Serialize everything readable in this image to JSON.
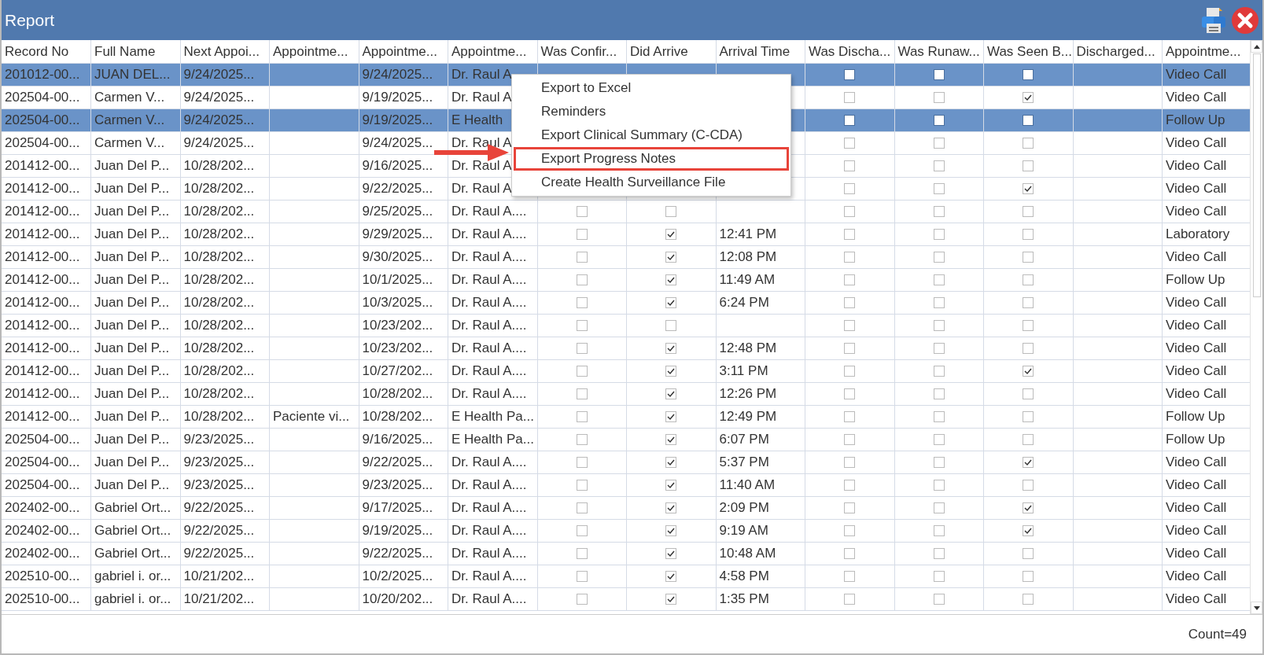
{
  "window": {
    "title": "Report"
  },
  "columns": [
    {
      "label": "Record No",
      "kind": "text"
    },
    {
      "label": "Full Name",
      "kind": "text"
    },
    {
      "label": "Next Appoi...",
      "kind": "text"
    },
    {
      "label": "Appointme...",
      "kind": "text"
    },
    {
      "label": "Appointme...",
      "kind": "text"
    },
    {
      "label": "Appointme...",
      "kind": "text"
    },
    {
      "label": "Was Confir...",
      "kind": "check"
    },
    {
      "label": "Did Arrive",
      "kind": "check"
    },
    {
      "label": "Arrival Time",
      "kind": "text"
    },
    {
      "label": "Was Discha...",
      "kind": "check"
    },
    {
      "label": "Was Runaw...",
      "kind": "check"
    },
    {
      "label": "Was Seen B...",
      "kind": "check"
    },
    {
      "label": "Discharged...",
      "kind": "text"
    },
    {
      "label": "Appointme...",
      "kind": "text"
    }
  ],
  "rows": [
    {
      "selected": true,
      "cells": [
        "201012-00...",
        "JUAN DEL...",
        "9/24/2025...",
        null,
        "9/24/2025...",
        "Dr. Raul A",
        null,
        null,
        null,
        {
          "checked": false
        },
        {
          "checked": false
        },
        {
          "checked": false
        },
        null,
        "Video Call"
      ]
    },
    {
      "selected": false,
      "cells": [
        "202504-00...",
        "Carmen V...",
        "9/24/2025...",
        null,
        "9/19/2025...",
        "Dr. Raul A",
        null,
        null,
        null,
        {
          "checked": false
        },
        {
          "checked": false
        },
        {
          "checked": true
        },
        null,
        "Video Call"
      ]
    },
    {
      "selected": true,
      "cells": [
        "202504-00...",
        "Carmen V...",
        "9/24/2025...",
        null,
        "9/19/2025...",
        "E Health",
        null,
        null,
        null,
        {
          "checked": false
        },
        {
          "checked": false
        },
        {
          "checked": false
        },
        null,
        "Follow Up"
      ]
    },
    {
      "selected": false,
      "cells": [
        "202504-00...",
        "Carmen V...",
        "9/24/2025...",
        null,
        "9/24/2025...",
        "Dr. Raul A",
        null,
        null,
        null,
        {
          "checked": false
        },
        {
          "checked": false
        },
        {
          "checked": false
        },
        null,
        "Video Call"
      ]
    },
    {
      "selected": false,
      "cells": [
        "201412-00...",
        "Juan Del P...",
        "10/28/202...",
        null,
        "9/16/2025...",
        "Dr. Raul A",
        null,
        null,
        null,
        {
          "checked": false
        },
        {
          "checked": false
        },
        {
          "checked": false
        },
        null,
        "Video Call"
      ]
    },
    {
      "selected": false,
      "cells": [
        "201412-00...",
        "Juan Del P...",
        "10/28/202...",
        null,
        "9/22/2025...",
        "Dr. Raul A",
        null,
        null,
        null,
        {
          "checked": false
        },
        {
          "checked": false
        },
        {
          "checked": true
        },
        null,
        "Video Call"
      ]
    },
    {
      "selected": false,
      "cells": [
        "201412-00...",
        "Juan Del P...",
        "10/28/202...",
        null,
        "9/25/2025...",
        "Dr. Raul A....",
        {
          "checked": false
        },
        {
          "checked": false
        },
        null,
        {
          "checked": false
        },
        {
          "checked": false
        },
        {
          "checked": false
        },
        null,
        "Video Call"
      ]
    },
    {
      "selected": false,
      "cells": [
        "201412-00...",
        "Juan Del P...",
        "10/28/202...",
        null,
        "9/29/2025...",
        "Dr. Raul A....",
        {
          "checked": false
        },
        {
          "checked": true
        },
        "12:41 PM",
        {
          "checked": false
        },
        {
          "checked": false
        },
        {
          "checked": false
        },
        null,
        "Laboratory"
      ]
    },
    {
      "selected": false,
      "cells": [
        "201412-00...",
        "Juan Del P...",
        "10/28/202...",
        null,
        "9/30/2025...",
        "Dr. Raul A....",
        {
          "checked": false
        },
        {
          "checked": true
        },
        "12:08 PM",
        {
          "checked": false
        },
        {
          "checked": false
        },
        {
          "checked": false
        },
        null,
        "Video Call"
      ]
    },
    {
      "selected": false,
      "cells": [
        "201412-00...",
        "Juan Del P...",
        "10/28/202...",
        null,
        "10/1/2025...",
        "Dr. Raul A....",
        {
          "checked": false
        },
        {
          "checked": true
        },
        "11:49 AM",
        {
          "checked": false
        },
        {
          "checked": false
        },
        {
          "checked": false
        },
        null,
        "Follow Up"
      ]
    },
    {
      "selected": false,
      "cells": [
        "201412-00...",
        "Juan Del P...",
        "10/28/202...",
        null,
        "10/3/2025...",
        "Dr. Raul A....",
        {
          "checked": false
        },
        {
          "checked": true
        },
        "6:24 PM",
        {
          "checked": false
        },
        {
          "checked": false
        },
        {
          "checked": false
        },
        null,
        "Video Call"
      ]
    },
    {
      "selected": false,
      "cells": [
        "201412-00...",
        "Juan Del P...",
        "10/28/202...",
        null,
        "10/23/202...",
        "Dr. Raul A....",
        {
          "checked": false
        },
        {
          "checked": false
        },
        null,
        {
          "checked": false
        },
        {
          "checked": false
        },
        {
          "checked": false
        },
        null,
        "Video Call"
      ]
    },
    {
      "selected": false,
      "cells": [
        "201412-00...",
        "Juan Del P...",
        "10/28/202...",
        null,
        "10/23/202...",
        "Dr. Raul A....",
        {
          "checked": false
        },
        {
          "checked": true
        },
        "12:48 PM",
        {
          "checked": false
        },
        {
          "checked": false
        },
        {
          "checked": false
        },
        null,
        "Video Call"
      ]
    },
    {
      "selected": false,
      "cells": [
        "201412-00...",
        "Juan Del P...",
        "10/28/202...",
        null,
        "10/27/202...",
        "Dr. Raul A....",
        {
          "checked": false
        },
        {
          "checked": true
        },
        "3:11 PM",
        {
          "checked": false
        },
        {
          "checked": false
        },
        {
          "checked": true
        },
        null,
        "Video Call"
      ]
    },
    {
      "selected": false,
      "cells": [
        "201412-00...",
        "Juan Del P...",
        "10/28/202...",
        null,
        "10/28/202...",
        "Dr. Raul A....",
        {
          "checked": false
        },
        {
          "checked": true
        },
        "12:26 PM",
        {
          "checked": false
        },
        {
          "checked": false
        },
        {
          "checked": false
        },
        null,
        "Video Call"
      ]
    },
    {
      "selected": false,
      "cells": [
        "201412-00...",
        "Juan Del P...",
        "10/28/202...",
        "Paciente vi...",
        "10/28/202...",
        "E Health Pa...",
        {
          "checked": false
        },
        {
          "checked": true
        },
        "12:49 PM",
        {
          "checked": false
        },
        {
          "checked": false
        },
        {
          "checked": false
        },
        null,
        "Follow Up"
      ]
    },
    {
      "selected": false,
      "cells": [
        "202504-00...",
        "Juan Del P...",
        "9/23/2025...",
        null,
        "9/16/2025...",
        "E Health Pa...",
        {
          "checked": false
        },
        {
          "checked": true
        },
        "6:07 PM",
        {
          "checked": false
        },
        {
          "checked": false
        },
        {
          "checked": false
        },
        null,
        "Follow Up"
      ]
    },
    {
      "selected": false,
      "cells": [
        "202504-00...",
        "Juan Del P...",
        "9/23/2025...",
        null,
        "9/22/2025...",
        "Dr. Raul A....",
        {
          "checked": false
        },
        {
          "checked": true
        },
        "5:37 PM",
        {
          "checked": false
        },
        {
          "checked": false
        },
        {
          "checked": true
        },
        null,
        "Video Call"
      ]
    },
    {
      "selected": false,
      "cells": [
        "202504-00...",
        "Juan Del P...",
        "9/23/2025...",
        null,
        "9/23/2025...",
        "Dr. Raul A....",
        {
          "checked": false
        },
        {
          "checked": true
        },
        "11:40 AM",
        {
          "checked": false
        },
        {
          "checked": false
        },
        {
          "checked": false
        },
        null,
        "Video Call"
      ]
    },
    {
      "selected": false,
      "cells": [
        "202402-00...",
        "Gabriel Ort...",
        "9/22/2025...",
        null,
        "9/17/2025...",
        "Dr. Raul A....",
        {
          "checked": false
        },
        {
          "checked": true
        },
        "2:09 PM",
        {
          "checked": false
        },
        {
          "checked": false
        },
        {
          "checked": true
        },
        null,
        "Video Call"
      ]
    },
    {
      "selected": false,
      "cells": [
        "202402-00...",
        "Gabriel Ort...",
        "9/22/2025...",
        null,
        "9/19/2025...",
        "Dr. Raul A....",
        {
          "checked": false
        },
        {
          "checked": true
        },
        "9:19 AM",
        {
          "checked": false
        },
        {
          "checked": false
        },
        {
          "checked": true
        },
        null,
        "Video Call"
      ]
    },
    {
      "selected": false,
      "cells": [
        "202402-00...",
        "Gabriel Ort...",
        "9/22/2025...",
        null,
        "9/22/2025...",
        "Dr. Raul A....",
        {
          "checked": false
        },
        {
          "checked": true
        },
        "10:48 AM",
        {
          "checked": false
        },
        {
          "checked": false
        },
        {
          "checked": false
        },
        null,
        "Video Call"
      ]
    },
    {
      "selected": false,
      "cells": [
        "202510-00...",
        "gabriel i. or...",
        "10/21/202...",
        null,
        "10/2/2025...",
        "Dr. Raul A....",
        {
          "checked": false
        },
        {
          "checked": true
        },
        "4:58 PM",
        {
          "checked": false
        },
        {
          "checked": false
        },
        {
          "checked": false
        },
        null,
        "Video Call"
      ]
    },
    {
      "selected": false,
      "cells": [
        "202510-00...",
        "gabriel i. or...",
        "10/21/202...",
        null,
        "10/20/202...",
        "Dr. Raul A....",
        {
          "checked": false
        },
        {
          "checked": true
        },
        "1:35 PM",
        {
          "checked": false
        },
        {
          "checked": false
        },
        {
          "checked": false
        },
        null,
        "Video Call"
      ]
    }
  ],
  "context_menu": {
    "items": [
      {
        "label": "Export to Excel",
        "highlighted": false
      },
      {
        "label": "Reminders",
        "highlighted": false
      },
      {
        "label": "Export Clinical Summary (C-CDA)",
        "highlighted": false
      },
      {
        "label": "Export Progress Notes",
        "highlighted": true
      },
      {
        "label": "Create Health Surveillance File",
        "highlighted": false
      }
    ]
  },
  "status_bar": {
    "count": "Count=49"
  }
}
